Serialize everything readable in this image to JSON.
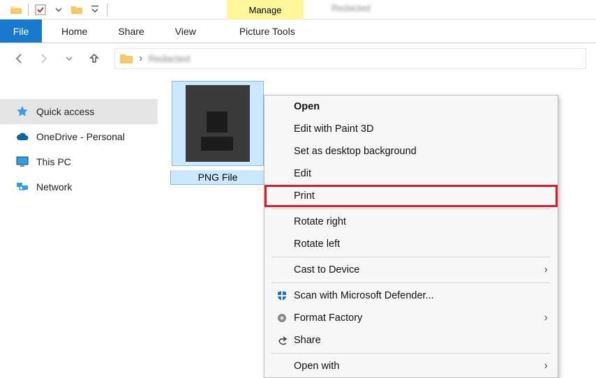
{
  "titlebar": {
    "manage_label": "Manage",
    "window_title": "Redacted"
  },
  "ribbon": {
    "file": "File",
    "home": "Home",
    "share": "Share",
    "view": "View",
    "picture_tools": "Picture Tools"
  },
  "address": {
    "path_text": "Redacted",
    "separator": "›"
  },
  "sidebar": {
    "items": [
      {
        "label": "Quick access"
      },
      {
        "label": "OneDrive - Personal"
      },
      {
        "label": "This PC"
      },
      {
        "label": "Network"
      }
    ]
  },
  "file": {
    "name": "PNG File"
  },
  "context_menu": {
    "open": "Open",
    "edit_paint3d": "Edit with Paint 3D",
    "set_bg": "Set as desktop background",
    "edit": "Edit",
    "print": "Print",
    "rotate_right": "Rotate right",
    "rotate_left": "Rotate left",
    "cast": "Cast to Device",
    "defender": "Scan with Microsoft Defender...",
    "format_factory": "Format Factory",
    "share": "Share",
    "open_with": "Open with"
  }
}
